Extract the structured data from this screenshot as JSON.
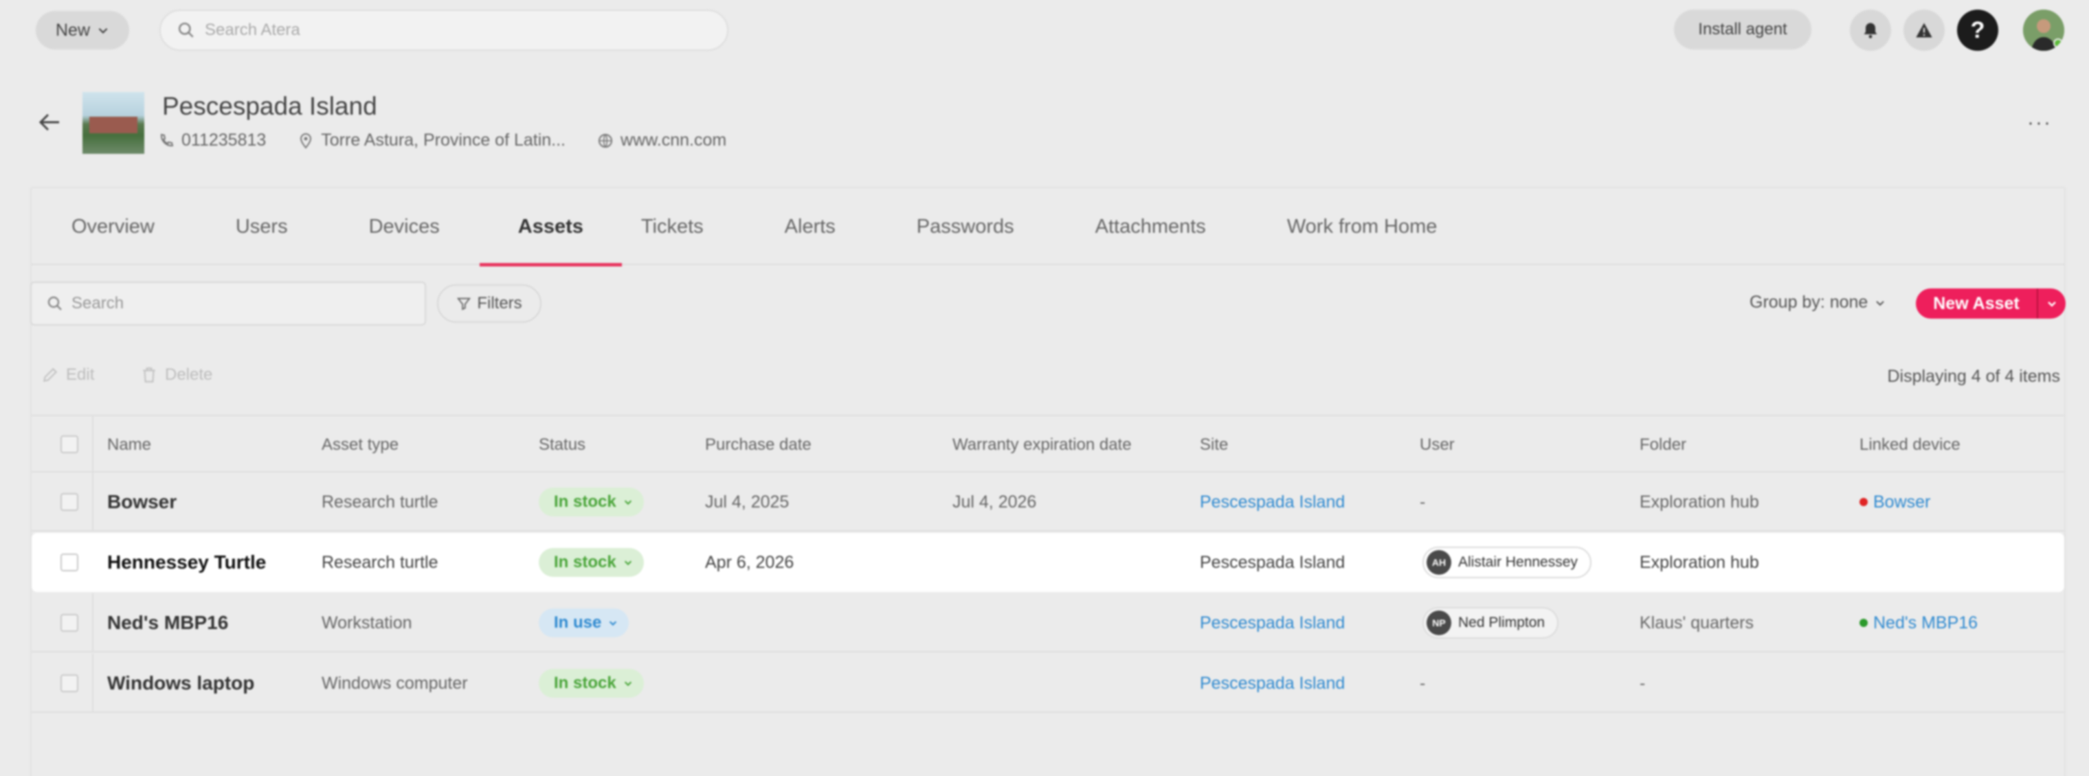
{
  "topbar": {
    "new_label": "New",
    "search_placeholder": "Search Atera",
    "install_label": "Install agent",
    "help_glyph": "?",
    "icons": [
      "bell-icon",
      "warning-icon",
      "help-icon"
    ]
  },
  "header": {
    "title": "Pescespada Island",
    "phone": "011235813",
    "address": "Torre Astura, Province of Latin...",
    "website": "www.cnn.com",
    "more_glyph": "···"
  },
  "tabs": [
    {
      "label": "Overview"
    },
    {
      "label": "Users"
    },
    {
      "label": "Devices"
    },
    {
      "label": "Assets"
    },
    {
      "label": "Tickets"
    },
    {
      "label": "Alerts"
    },
    {
      "label": "Passwords"
    },
    {
      "label": "Attachments"
    },
    {
      "label": "Work from Home"
    }
  ],
  "active_tab": "Assets",
  "toolbar": {
    "search_placeholder": "Search",
    "filters_label": "Filters",
    "groupby_label": "Group by: none",
    "new_asset_label": "New Asset"
  },
  "actions": {
    "edit_label": "Edit",
    "delete_label": "Delete",
    "displaying": "Displaying 4 of 4 items"
  },
  "table": {
    "columns": [
      "Name",
      "Asset type",
      "Status",
      "Purchase date",
      "Warranty expiration date",
      "Site",
      "User",
      "Folder",
      "Linked device"
    ],
    "rows": [
      {
        "name": "Bowser",
        "type": "Research turtle",
        "status": "In stock",
        "purchase": "Jul 4, 2025",
        "warranty": "Jul 4, 2026",
        "site": "Pescespada Island",
        "user": "-",
        "user_initials": "",
        "folder": "Exploration hub",
        "linked": "Bowser",
        "linked_color": "#e02424"
      },
      {
        "name": "Hennessey Turtle",
        "type": "Research turtle",
        "status": "In stock",
        "purchase": "Apr 6, 2026",
        "warranty": "",
        "site": "Pescespada Island",
        "user": "Alistair Hennessey",
        "user_initials": "AH",
        "folder": "Exploration hub",
        "linked": "",
        "linked_color": ""
      },
      {
        "name": "Ned's MBP16",
        "type": "Workstation",
        "status": "In use",
        "purchase": "",
        "warranty": "",
        "site": "Pescespada Island",
        "user": "Ned Plimpton",
        "user_initials": "NP",
        "folder": "Klaus' quarters",
        "linked": "Ned's MBP16",
        "linked_color": "#2c9a2c"
      },
      {
        "name": "Windows laptop",
        "type": "Windows computer",
        "status": "In stock",
        "purchase": "",
        "warranty": "",
        "site": "Pescespada Island",
        "user": "-",
        "user_initials": "",
        "folder": "-",
        "linked": "",
        "linked_color": ""
      }
    ]
  },
  "colors": {
    "accent": "#ee1f5c",
    "tab_underline": "#e8365f",
    "link": "#2f8ad0",
    "in_stock": "#4aa53a",
    "in_use": "#2f8ad0"
  }
}
